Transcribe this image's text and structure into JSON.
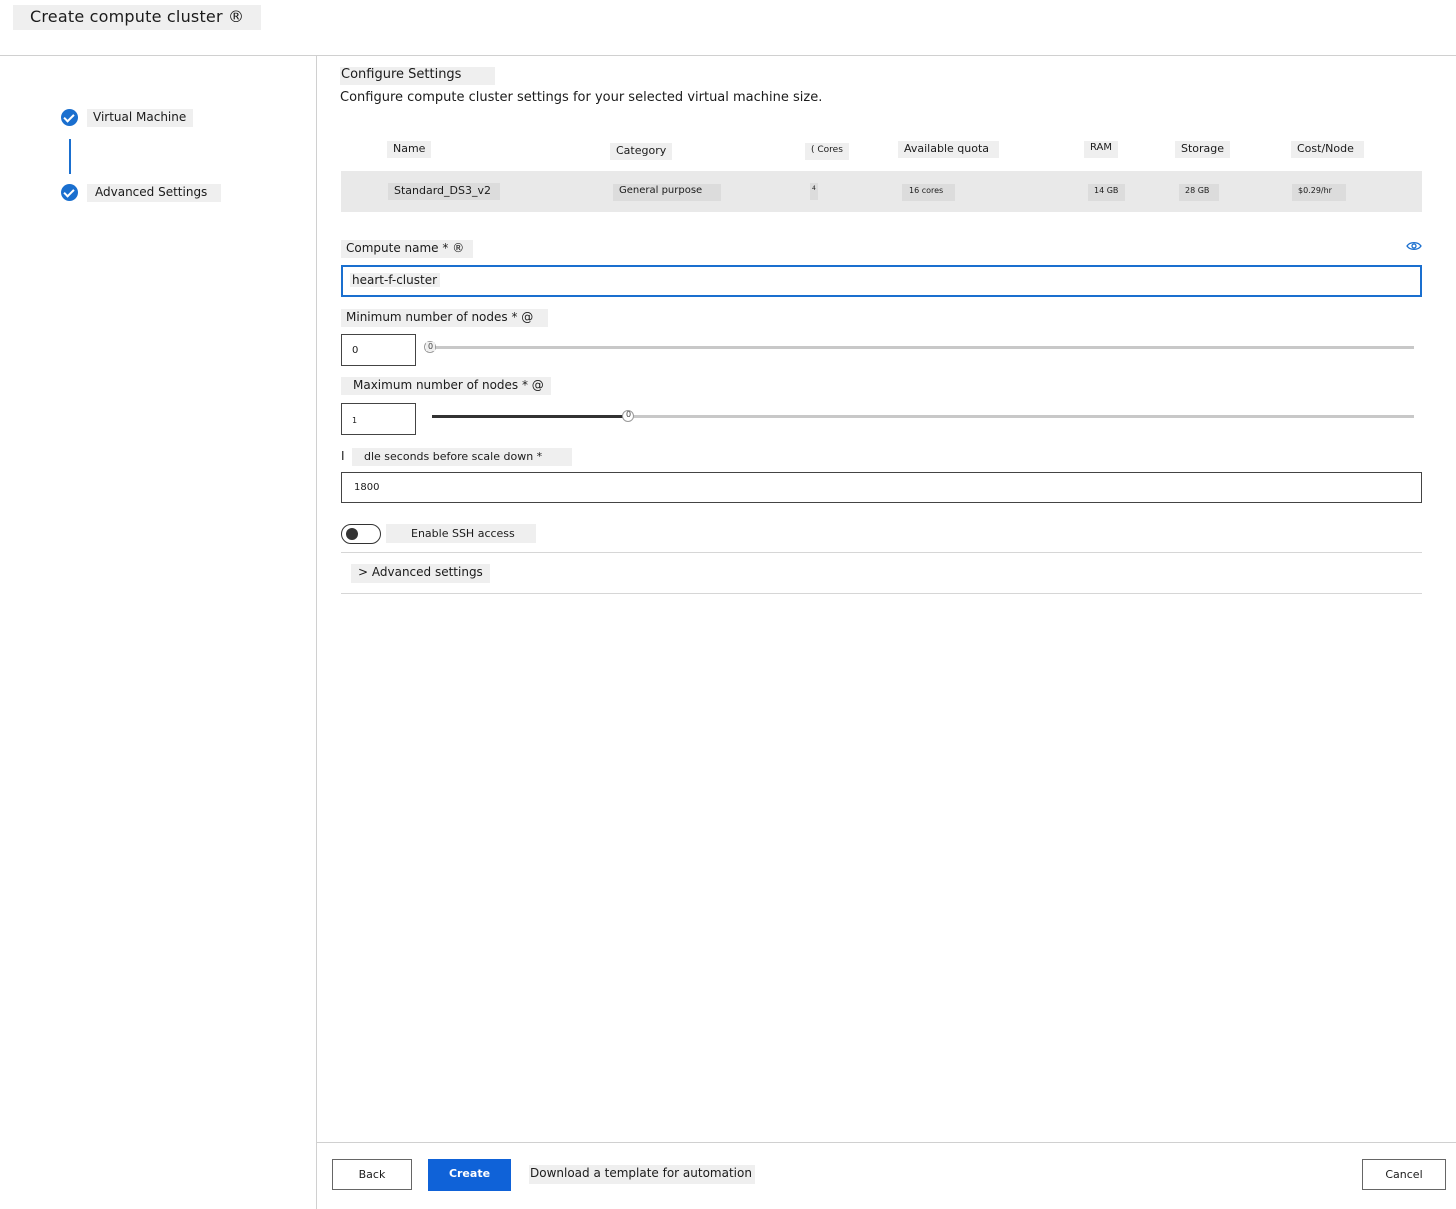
{
  "header": {
    "title": "Create compute cluster ®"
  },
  "steps": [
    {
      "label": "Virtual Machine",
      "status": "complete"
    },
    {
      "label": "Advanced Settings",
      "status": "complete"
    }
  ],
  "main": {
    "section_title": "Configure Settings",
    "section_desc": "Configure compute cluster settings for your selected virtual machine size.",
    "table": {
      "headers": [
        "Name",
        "Category",
        "( Cores",
        "Available quota",
        "RAM",
        "Storage",
        "Cost/Node"
      ],
      "row": [
        "Standard_DS3_v2",
        "General purpose",
        "4",
        "16 cores",
        "14 GB",
        "28 GB",
        "$0.29/hr"
      ]
    },
    "compute_name": {
      "label": "Compute name * ®",
      "value": "heart-f-cluster"
    },
    "min_nodes": {
      "label": "Minimum number of nodes * @",
      "value": "0",
      "thumb_label": "0",
      "level": 0
    },
    "max_nodes": {
      "label": "Maximum number of nodes * @",
      "value": "1",
      "thumb_label": "0",
      "level": 0.2
    },
    "idle": {
      "label_prefix": "I",
      "label": "dle seconds before scale down *",
      "value": "1800"
    },
    "ssh": {
      "label": "Enable SSH access",
      "enabled": false
    },
    "advanced": {
      "label": "> Advanced settings"
    }
  },
  "footer": {
    "back": "Back",
    "create": "Create",
    "download": "Download a template for automation",
    "cancel": "Cancel"
  },
  "colors": {
    "accent": "#1a6fcf",
    "primary_button": "#0f62d8"
  },
  "icons": {
    "step_status": "check-circle-icon",
    "name_availability": "eye-icon",
    "chevron": "chevron-right-icon"
  }
}
